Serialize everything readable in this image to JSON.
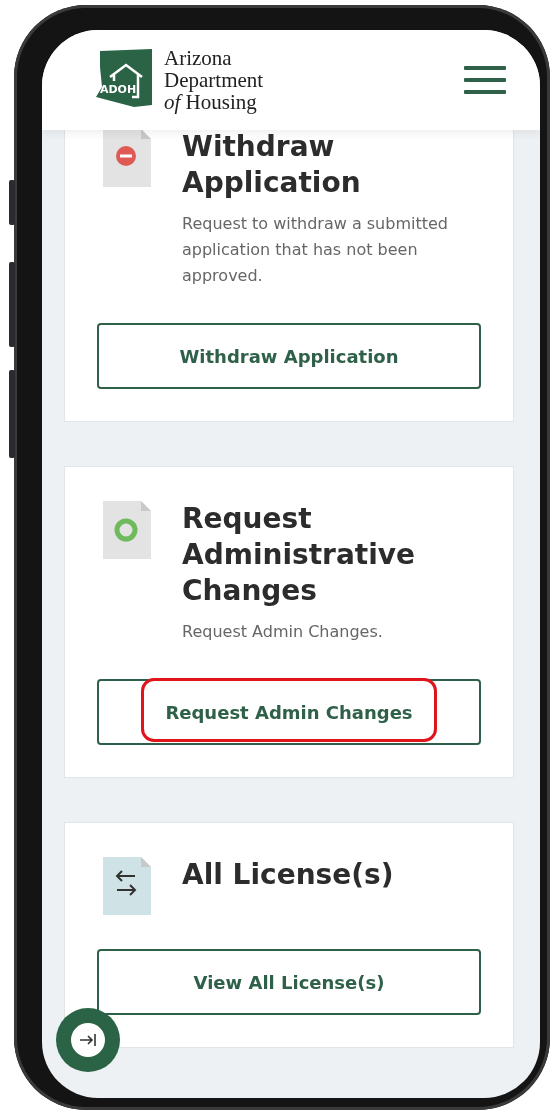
{
  "header": {
    "logo_abbreviation": "ADOH",
    "logo_lines": [
      "Arizona",
      "Department",
      "*of* Housing"
    ]
  },
  "cards": [
    {
      "kind": "remove",
      "title": "Withdraw Application",
      "description": "Request to withdraw a submitted application that has not been approved.",
      "button": {
        "label": "Withdraw Application",
        "highlighted": false
      }
    },
    {
      "kind": "ring",
      "title": "Request Administrative Changes",
      "description": "Request Admin Changes.",
      "button": {
        "label": "Request Admin Changes",
        "highlighted": true
      }
    },
    {
      "kind": "swap",
      "title": "All License(s)",
      "button": {
        "label": "View All License(s)",
        "highlighted": false
      }
    }
  ]
}
